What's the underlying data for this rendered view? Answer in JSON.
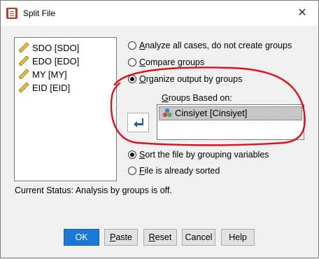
{
  "window": {
    "title": "Split File",
    "close_glyph": "✕"
  },
  "variables": [
    {
      "label": "SDO [SDO]",
      "icon": "scale-ruler-icon"
    },
    {
      "label": "EDO [EDO]",
      "icon": "scale-ruler-icon"
    },
    {
      "label": "MY [MY]",
      "icon": "scale-ruler-icon"
    },
    {
      "label": "EID [EID]",
      "icon": "scale-ruler-icon"
    }
  ],
  "mode_options": [
    {
      "key": "A",
      "rest": "nalyze all cases, do not create groups",
      "selected": false
    },
    {
      "key": "C",
      "rest": "ompare groups",
      "selected": false
    },
    {
      "key": "O",
      "rest": "rganize output by groups",
      "selected": true
    }
  ],
  "groups": {
    "label_key": "G",
    "label_rest": "roups Based on:",
    "items": [
      {
        "label": "Cinsiyet [Cinsiyet]",
        "icon": "nominal-circles-icon"
      }
    ]
  },
  "sort_options": [
    {
      "key": "S",
      "rest": "ort the file by grouping variables",
      "selected": true
    },
    {
      "key": "F",
      "rest": "ile is already sorted",
      "selected": false
    }
  ],
  "status": "Current Status: Analysis by groups is off.",
  "buttons": {
    "ok": "OK",
    "paste_key": "P",
    "paste_rest": "aste",
    "reset_key": "R",
    "reset_rest": "eset",
    "cancel": "Cancel",
    "help": "Help"
  },
  "colors": {
    "primary": "#1b78d6",
    "annotation": "#e0101a"
  }
}
